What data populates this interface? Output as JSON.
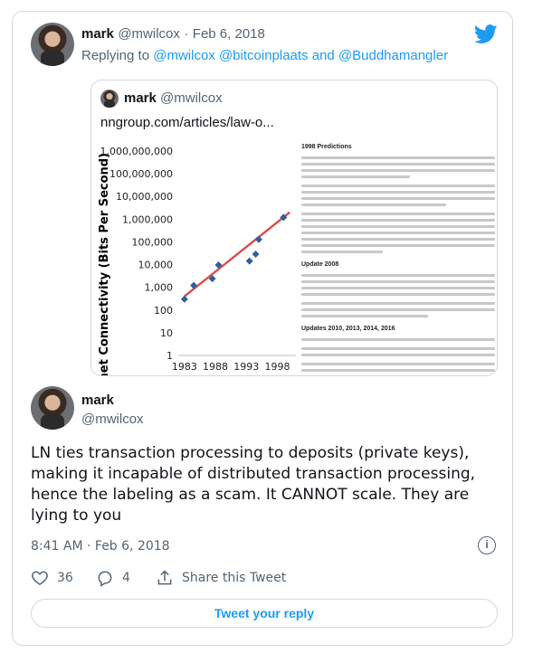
{
  "parent_tweet": {
    "display_name": "mark",
    "handle": "@mwilcox",
    "separator": "·",
    "date": "Feb 6, 2018",
    "replying_prefix": "Replying to",
    "replying_to": "@mwilcox @bitcoinplaats and @Buddhamangler"
  },
  "quoted_tweet": {
    "display_name": "mark",
    "handle": "@mwilcox",
    "link": "nngroup.com/articles/law-o...",
    "image": {
      "chart_data": {
        "type": "scatter",
        "ylabel": "Internet Connectivity (Bits Per Second)",
        "ytick_labels": [
          "1,000,000,000",
          "100,000,000",
          "10,000,000",
          "1,000,000",
          "100,000",
          "10,000",
          "1,000",
          "100",
          "10",
          "1"
        ],
        "xtick_labels": [
          "1983",
          "1988",
          "1993",
          "1998"
        ],
        "y_scale": "log",
        "ylim": [
          1,
          1000000000
        ],
        "xlim": [
          1982,
          2001
        ],
        "points": [
          {
            "x": 1983,
            "y": 300
          },
          {
            "x": 1984.5,
            "y": 1200
          },
          {
            "x": 1987.5,
            "y": 2400
          },
          {
            "x": 1988.5,
            "y": 9600
          },
          {
            "x": 1993.5,
            "y": 14400
          },
          {
            "x": 1994.5,
            "y": 28800
          },
          {
            "x": 1995,
            "y": 128000
          },
          {
            "x": 1999,
            "y": 1200000
          }
        ],
        "trend_line": {
          "x": [
            1983,
            2000
          ],
          "y": [
            400,
            2000000
          ]
        },
        "point_color": "#2f5f9e",
        "trend_color": "#d9534f"
      },
      "article_headings": [
        "1998 Predictions",
        "Update 2008",
        "Updates 2010, 2013, 2014, 2016"
      ]
    }
  },
  "reply_tweet": {
    "display_name": "mark",
    "handle": "@mwilcox",
    "text": "LN ties transaction processing to deposits (private keys), making it incapable of distributed transaction processing, hence the labeling as a scam. It CANNOT scale. They are lying to you",
    "time": "8:41 AM",
    "separator": "·",
    "date": "Feb 6, 2018"
  },
  "actions": {
    "like_count": "36",
    "reply_count": "4",
    "share_label": "Share this Tweet"
  },
  "reply_button_label": "Tweet your reply",
  "colors": {
    "accent": "#1d9bf0",
    "text": "#0f1419",
    "muted": "#536471",
    "border": "#cfd9de"
  },
  "icons": [
    "twitter-bird-icon",
    "info-icon",
    "heart-icon",
    "reply-icon",
    "share-icon"
  ]
}
